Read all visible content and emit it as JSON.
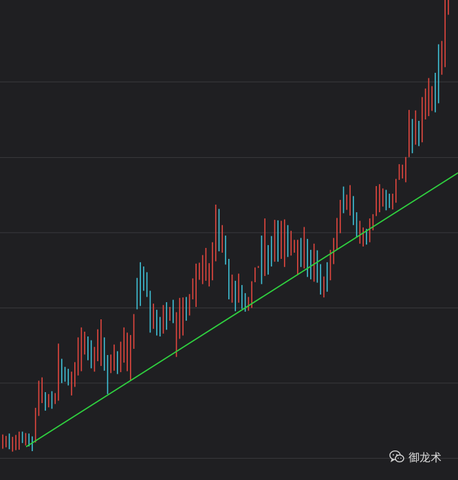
{
  "colors": {
    "background": "#1f1f22",
    "grid": "#3a3a3e",
    "up": "#e5473f",
    "down": "#3fc3d9",
    "trendline": "#2fd13f"
  },
  "watermark": {
    "text": "御龙术",
    "icon": "wechat-icon"
  },
  "chart_data": {
    "type": "bar",
    "subtype": "ohlc-price-chart",
    "title": "",
    "xlabel": "",
    "ylabel": "",
    "ylim": [
      0,
      100
    ],
    "grid": "horizontal",
    "legend": "none",
    "gridlines_y": [
      3.7,
      19.5,
      35.3,
      51.1,
      66.9,
      82.8
    ],
    "bars": [
      {
        "d": "u",
        "h": 8.7,
        "l": 5.7
      },
      {
        "d": "u",
        "h": 8.4,
        "l": 6.0
      },
      {
        "d": "d",
        "h": 8.9,
        "l": 5.6
      },
      {
        "d": "u",
        "h": 8.2,
        "l": 5.1
      },
      {
        "d": "u",
        "h": 8.6,
        "l": 5.4
      },
      {
        "d": "u",
        "h": 9.3,
        "l": 5.5
      },
      {
        "d": "d",
        "h": 9.3,
        "l": 6.9
      },
      {
        "d": "u",
        "h": 9.0,
        "l": 6.4
      },
      {
        "d": "d",
        "h": 8.9,
        "l": 6.2
      },
      {
        "d": "d",
        "h": 8.3,
        "l": 5.2
      },
      {
        "d": "u",
        "h": 14.3,
        "l": 7.0
      },
      {
        "d": "u",
        "h": 20.0,
        "l": 12.6
      },
      {
        "d": "u",
        "h": 20.7,
        "l": 15.3
      },
      {
        "d": "d",
        "h": 17.6,
        "l": 13.7
      },
      {
        "d": "u",
        "h": 17.2,
        "l": 14.4
      },
      {
        "d": "d",
        "h": 17.8,
        "l": 14.1
      },
      {
        "d": "u",
        "h": 17.4,
        "l": 15.1
      },
      {
        "d": "u",
        "h": 27.8,
        "l": 15.8
      },
      {
        "d": "d",
        "h": 24.6,
        "l": 19.5
      },
      {
        "d": "d",
        "h": 22.9,
        "l": 19.8
      },
      {
        "d": "d",
        "h": 22.5,
        "l": 19.0
      },
      {
        "d": "u",
        "h": 21.9,
        "l": 16.9
      },
      {
        "d": "u",
        "h": 23.9,
        "l": 18.7
      },
      {
        "d": "u",
        "h": 29.1,
        "l": 21.1
      },
      {
        "d": "u",
        "h": 31.2,
        "l": 22.0
      },
      {
        "d": "u",
        "h": 30.3,
        "l": 25.5
      },
      {
        "d": "d",
        "h": 29.3,
        "l": 24.3
      },
      {
        "d": "d",
        "h": 28.5,
        "l": 22.6
      },
      {
        "d": "u",
        "h": 27.1,
        "l": 21.9
      },
      {
        "d": "u",
        "h": 30.8,
        "l": 24.1
      },
      {
        "d": "u",
        "h": 32.9,
        "l": 23.1
      },
      {
        "d": "d",
        "h": 29.1,
        "l": 22.1
      },
      {
        "d": "d",
        "h": 25.4,
        "l": 17.2
      },
      {
        "d": "u",
        "h": 25.5,
        "l": 21.6
      },
      {
        "d": "u",
        "h": 27.6,
        "l": 22.1
      },
      {
        "d": "d",
        "h": 26.2,
        "l": 21.4
      },
      {
        "d": "u",
        "h": 28.2,
        "l": 21.8
      },
      {
        "d": "u",
        "h": 31.2,
        "l": 23.8
      },
      {
        "d": "u",
        "h": 30.1,
        "l": 22.0
      },
      {
        "d": "u",
        "h": 29.6,
        "l": 20.1
      },
      {
        "d": "u",
        "h": 34.0,
        "l": 26.7
      },
      {
        "d": "d",
        "h": 41.6,
        "l": 35.0
      },
      {
        "d": "d",
        "h": 44.9,
        "l": 35.7
      },
      {
        "d": "d",
        "h": 44.0,
        "l": 38.9
      },
      {
        "d": "d",
        "h": 42.8,
        "l": 37.6
      },
      {
        "d": "d",
        "h": 38.9,
        "l": 30.1
      },
      {
        "d": "u",
        "h": 36.2,
        "l": 30.9
      },
      {
        "d": "d",
        "h": 34.9,
        "l": 29.5
      },
      {
        "d": "d",
        "h": 33.4,
        "l": 29.3
      },
      {
        "d": "u",
        "h": 35.9,
        "l": 29.9
      },
      {
        "d": "d",
        "h": 36.5,
        "l": 30.7
      },
      {
        "d": "u",
        "h": 35.5,
        "l": 32.6
      },
      {
        "d": "d",
        "h": 37.0,
        "l": 32.1
      },
      {
        "d": "u",
        "h": 34.4,
        "l": 25.0
      },
      {
        "d": "u",
        "h": 37.4,
        "l": 28.8
      },
      {
        "d": "u",
        "h": 37.5,
        "l": 29.5
      },
      {
        "d": "d",
        "h": 37.6,
        "l": 32.6
      },
      {
        "d": "u",
        "h": 38.2,
        "l": 33.7
      },
      {
        "d": "u",
        "h": 41.5,
        "l": 37.1
      },
      {
        "d": "u",
        "h": 44.6,
        "l": 35.5
      },
      {
        "d": "u",
        "h": 44.8,
        "l": 41.2
      },
      {
        "d": "u",
        "h": 46.4,
        "l": 40.3
      },
      {
        "d": "u",
        "h": 47.9,
        "l": 41.0
      },
      {
        "d": "u",
        "h": 44.7,
        "l": 39.8
      },
      {
        "d": "u",
        "h": 49.1,
        "l": 41.1
      },
      {
        "d": "u",
        "h": 57.0,
        "l": 45.1
      },
      {
        "d": "d",
        "h": 56.1,
        "l": 47.2
      },
      {
        "d": "u",
        "h": 52.7,
        "l": 46.9
      },
      {
        "d": "d",
        "h": 50.5,
        "l": 44.4
      },
      {
        "d": "d",
        "h": 45.6,
        "l": 37.1
      },
      {
        "d": "u",
        "h": 42.3,
        "l": 36.4
      },
      {
        "d": "d",
        "h": 41.0,
        "l": 34.6
      },
      {
        "d": "u",
        "h": 42.5,
        "l": 36.4
      },
      {
        "d": "d",
        "h": 40.1,
        "l": 35.1
      },
      {
        "d": "d",
        "h": 38.4,
        "l": 34.5
      },
      {
        "d": "u",
        "h": 37.6,
        "l": 34.7
      },
      {
        "d": "u",
        "h": 40.9,
        "l": 35.3
      },
      {
        "d": "u",
        "h": 43.8,
        "l": 40.7
      },
      {
        "d": "u",
        "h": 44.1,
        "l": 43.7
      },
      {
        "d": "d",
        "h": 50.5,
        "l": 40.3
      },
      {
        "d": "u",
        "h": 54.1,
        "l": 42.0
      },
      {
        "d": "d",
        "h": 48.5,
        "l": 42.3
      },
      {
        "d": "d",
        "h": 50.4,
        "l": 44.0
      },
      {
        "d": "u",
        "h": 53.8,
        "l": 45.0
      },
      {
        "d": "d",
        "h": 53.7,
        "l": 45.0
      },
      {
        "d": "u",
        "h": 53.6,
        "l": 45.6
      },
      {
        "d": "u",
        "h": 53.9,
        "l": 43.9
      },
      {
        "d": "d",
        "h": 52.7,
        "l": 46.0
      },
      {
        "d": "u",
        "h": 51.5,
        "l": 46.3
      },
      {
        "d": "u",
        "h": 49.6,
        "l": 46.9
      },
      {
        "d": "u",
        "h": 49.6,
        "l": 42.2
      },
      {
        "d": "d",
        "h": 50.0,
        "l": 43.9
      },
      {
        "d": "u",
        "h": 52.3,
        "l": 43.6
      },
      {
        "d": "d",
        "h": 49.8,
        "l": 41.8
      },
      {
        "d": "d",
        "h": 47.5,
        "l": 41.3
      },
      {
        "d": "u",
        "h": 48.8,
        "l": 40.8
      },
      {
        "d": "d",
        "h": 47.4,
        "l": 40.6
      },
      {
        "d": "d",
        "h": 44.5,
        "l": 38.1
      },
      {
        "d": "u",
        "h": 41.9,
        "l": 37.5
      },
      {
        "d": "d",
        "h": 44.9,
        "l": 38.7
      },
      {
        "d": "u",
        "h": 47.5,
        "l": 41.1
      },
      {
        "d": "u",
        "h": 50.0,
        "l": 44.5
      },
      {
        "d": "u",
        "h": 54.2,
        "l": 47.5
      },
      {
        "d": "u",
        "h": 58.0,
        "l": 51.0
      },
      {
        "d": "d",
        "h": 60.8,
        "l": 55.2
      },
      {
        "d": "u",
        "h": 59.1,
        "l": 55.9
      },
      {
        "d": "u",
        "h": 61.1,
        "l": 54.7
      },
      {
        "d": "d",
        "h": 58.8,
        "l": 52.7
      },
      {
        "d": "d",
        "h": 55.4,
        "l": 50.2
      },
      {
        "d": "u",
        "h": 53.6,
        "l": 48.8
      },
      {
        "d": "u",
        "h": 52.2,
        "l": 48.2
      },
      {
        "d": "d",
        "h": 51.9,
        "l": 48.6
      },
      {
        "d": "u",
        "h": 54.1,
        "l": 49.1
      },
      {
        "d": "u",
        "h": 55.0,
        "l": 51.6
      },
      {
        "d": "u",
        "h": 60.9,
        "l": 54.6
      },
      {
        "d": "u",
        "h": 61.3,
        "l": 55.4
      },
      {
        "d": "u",
        "h": 60.4,
        "l": 56.6
      },
      {
        "d": "d",
        "h": 60.1,
        "l": 55.8
      },
      {
        "d": "d",
        "h": 59.3,
        "l": 56.3
      },
      {
        "d": "u",
        "h": 59.3,
        "l": 56.0
      },
      {
        "d": "u",
        "h": 62.4,
        "l": 57.4
      },
      {
        "d": "u",
        "h": 65.5,
        "l": 62.2
      },
      {
        "d": "u",
        "h": 65.4,
        "l": 62.5
      },
      {
        "d": "u",
        "h": 67.0,
        "l": 61.7
      },
      {
        "d": "u",
        "h": 76.9,
        "l": 67.0
      },
      {
        "d": "d",
        "h": 75.0,
        "l": 67.8
      },
      {
        "d": "u",
        "h": 76.8,
        "l": 69.6
      },
      {
        "d": "d",
        "h": 74.6,
        "l": 69.3
      },
      {
        "d": "u",
        "h": 79.6,
        "l": 70.1
      },
      {
        "d": "u",
        "h": 81.4,
        "l": 74.9
      },
      {
        "d": "u",
        "h": 83.6,
        "l": 75.6
      },
      {
        "d": "u",
        "h": 81.9,
        "l": 76.7
      },
      {
        "d": "d",
        "h": 84.7,
        "l": 76.4
      },
      {
        "d": "d",
        "h": 90.7,
        "l": 78.3
      },
      {
        "d": "u",
        "h": 91.4,
        "l": 84.3
      },
      {
        "d": "u",
        "h": 100.0,
        "l": 85.9
      },
      {
        "d": "u",
        "h": 100.0,
        "l": 96.9
      }
    ],
    "trendline": {
      "from": [
        0,
        3.0
      ],
      "to": [
        139,
        63.7
      ]
    }
  }
}
